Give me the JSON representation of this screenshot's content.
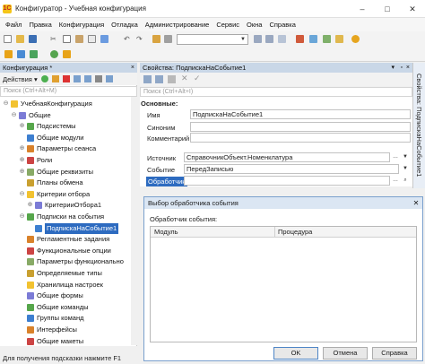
{
  "window": {
    "title": "Конфигуратор - Учебная конфигурация",
    "minimize": "–",
    "maximize": "□",
    "close": "✕"
  },
  "menu": [
    "Файл",
    "Правка",
    "Конфигурация",
    "Отладка",
    "Администрирование",
    "Сервис",
    "Окна",
    "Справка"
  ],
  "toolbar": {
    "combo_value": ""
  },
  "left_panel": {
    "header": "Конфигурация *",
    "close": "×",
    "actions_label": "Действия ▾",
    "search_placeholder": "Поиск (Ctrl+Alt+M)",
    "tree": [
      {
        "label": "УчебнаяКонфигурация",
        "level": 0,
        "expander": "⊖",
        "icon": "config-root-icon"
      },
      {
        "label": "Общие",
        "level": 1,
        "expander": "⊖",
        "icon": "folder-common-icon"
      },
      {
        "label": "Подсистемы",
        "level": 2,
        "expander": "⊕",
        "icon": "subsystems-icon"
      },
      {
        "label": "Общие модули",
        "level": 2,
        "expander": "",
        "icon": "common-modules-icon"
      },
      {
        "label": "Параметры сеанса",
        "level": 2,
        "expander": "⊕",
        "icon": "session-params-icon"
      },
      {
        "label": "Роли",
        "level": 2,
        "expander": "⊕",
        "icon": "roles-icon"
      },
      {
        "label": "Общие реквизиты",
        "level": 2,
        "expander": "⊕",
        "icon": "common-attributes-icon"
      },
      {
        "label": "Планы обмена",
        "level": 2,
        "expander": "",
        "icon": "exchange-plans-icon"
      },
      {
        "label": "Критерии отбора",
        "level": 2,
        "expander": "⊖",
        "icon": "filter-criteria-icon"
      },
      {
        "label": "КритерииОтбора1",
        "level": 3,
        "expander": "⊕",
        "icon": "filter-criterion-icon"
      },
      {
        "label": "Подписки на события",
        "level": 2,
        "expander": "⊖",
        "icon": "event-subscriptions-icon"
      },
      {
        "label": "ПодпискаНаСобытие1",
        "level": 3,
        "expander": "",
        "icon": "event-subscription-icon",
        "selected": true
      },
      {
        "label": "Регламентные задания",
        "level": 2,
        "expander": "",
        "icon": "scheduled-jobs-icon"
      },
      {
        "label": "Функциональные опции",
        "level": 2,
        "expander": "",
        "icon": "functional-options-icon"
      },
      {
        "label": "Параметры функционально",
        "level": 2,
        "expander": "",
        "icon": "functional-params-icon"
      },
      {
        "label": "Определяемые типы",
        "level": 2,
        "expander": "",
        "icon": "defined-types-icon"
      },
      {
        "label": "Хранилища настроек",
        "level": 2,
        "expander": "",
        "icon": "settings-storages-icon"
      },
      {
        "label": "Общие формы",
        "level": 2,
        "expander": "",
        "icon": "common-forms-icon"
      },
      {
        "label": "Общие команды",
        "level": 2,
        "expander": "",
        "icon": "common-commands-icon"
      },
      {
        "label": "Группы команд",
        "level": 2,
        "expander": "",
        "icon": "command-groups-icon"
      },
      {
        "label": "Интерфейсы",
        "level": 2,
        "expander": "",
        "icon": "interfaces-icon"
      },
      {
        "label": "Общие макеты",
        "level": 2,
        "expander": "",
        "icon": "common-templates-icon"
      }
    ]
  },
  "properties": {
    "header": "Свойства: ПодпискаНаСобытие1",
    "search_placeholder": "Поиск (Ctrl+Alt+I)",
    "section": "Основные:",
    "fields": {
      "name_label": "Имя",
      "name_value": "ПодпискаНаСобытие1",
      "synonym_label": "Синоним",
      "synonym_value": "",
      "comment_label": "Комментарий",
      "comment_value": "",
      "source_label": "Источник",
      "source_value": "СправочникОбъект.Номенклатура",
      "event_label": "Событие",
      "event_value": "ПередЗаписью",
      "handler_label": "Обработчик",
      "handler_value": ""
    },
    "side_tab": "Свойства: ПодпискаНаСобытие1"
  },
  "dialog": {
    "title": "Выбор обработчика события",
    "close": "✕",
    "label": "Обработчик события:",
    "columns": [
      "Модуль",
      "Процедура"
    ],
    "buttons": {
      "ok": "OK",
      "cancel": "Отмена",
      "help": "Справка"
    }
  },
  "status": "Для получения подсказки нажмите F1"
}
